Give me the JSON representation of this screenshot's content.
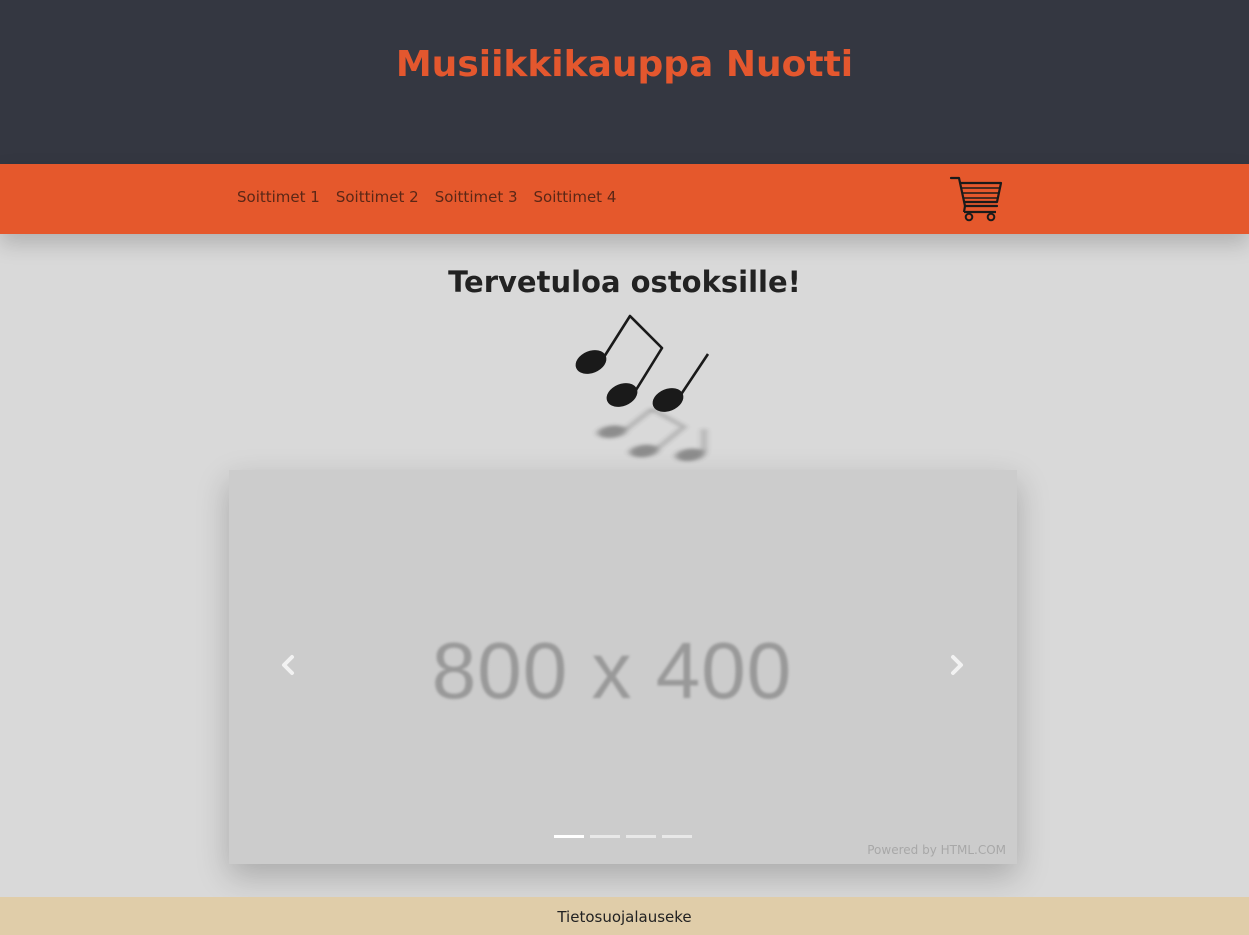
{
  "header": {
    "title": "Musiikkikauppa Nuotti",
    "title_color": "#e4572e",
    "background": "#343741"
  },
  "nav": {
    "background": "#e5582c",
    "items": [
      {
        "label": "Soittimet 1"
      },
      {
        "label": "Soittimet 2"
      },
      {
        "label": "Soittimet 3"
      },
      {
        "label": "Soittimet 4"
      }
    ],
    "cart_icon": "shopping-cart-icon"
  },
  "main": {
    "welcome": "Tervetuloa ostoksille!",
    "notes_icon": "music-notes-icon"
  },
  "carousel": {
    "placeholder": "800 x 400",
    "prev_icon": "chevron-left-icon",
    "next_icon": "chevron-right-icon",
    "indicator_count": 4,
    "active_index": 0,
    "powered_by": "Powered by HTML.COM"
  },
  "footer": {
    "link": "Tietosuojalauseke",
    "background": "#e0cda9"
  }
}
